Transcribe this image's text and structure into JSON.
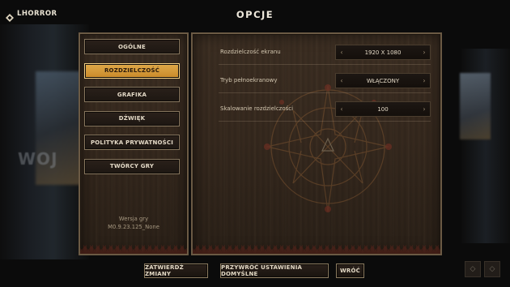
{
  "header": {
    "username": "LHORROR",
    "title": "OPCJE"
  },
  "background": {
    "logo_text": "WOJ"
  },
  "sidebar": {
    "items": [
      {
        "label": "OGÓLNE",
        "active": false
      },
      {
        "label": "ROZDZIELCZOŚĆ",
        "active": true
      },
      {
        "label": "GRAFIKA",
        "active": false
      },
      {
        "label": "DŹWIĘK",
        "active": false
      },
      {
        "label": "POLITYKA PRYWATNOŚCI",
        "active": false
      },
      {
        "label": "TWÓRCY GRY",
        "active": false
      }
    ],
    "version_label": "Wersja gry",
    "version_value": "M0.9.23.125_None"
  },
  "settings": [
    {
      "label": "Rozdzielczość ekranu",
      "value": "1920 X 1080"
    },
    {
      "label": "Tryb pełnoekranowy",
      "value": "WŁĄCZONY"
    },
    {
      "label": "Skalowanie rozdzielczości",
      "value": "100"
    }
  ],
  "footer": {
    "confirm_label": "ZATWIERDŹ ZMIANY",
    "reset_label": "PRZYWRÓĆ USTAWIENIA DOMYŚLNE",
    "back_label": "WRÓĆ"
  },
  "icons": {
    "user": "diamond-icon",
    "prev": "chevron-left-icon",
    "next": "chevron-right-icon"
  },
  "colors": {
    "active_tab": "#d99a3a",
    "panel_wood": "#36291e",
    "border": "#6b5a44"
  }
}
